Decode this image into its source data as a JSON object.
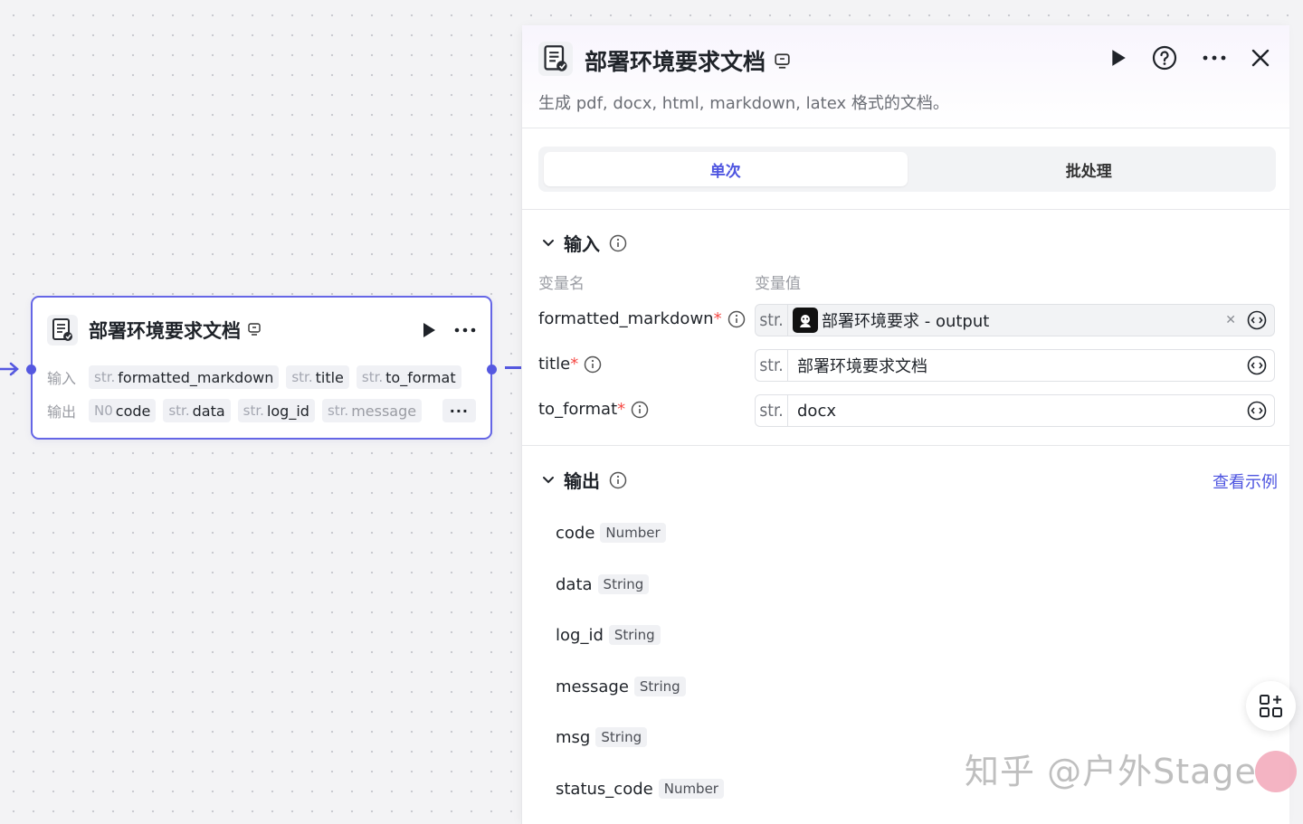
{
  "node": {
    "title": "部署环境要求文档",
    "input_label": "输入",
    "output_label": "输出",
    "inputs": [
      {
        "type": "str.",
        "name": "formatted_markdown"
      },
      {
        "type": "str.",
        "name": "title"
      },
      {
        "type": "str.",
        "name": "to_format"
      }
    ],
    "outputs": [
      {
        "type": "N0",
        "name": "code"
      },
      {
        "type": "str.",
        "name": "data"
      },
      {
        "type": "str.",
        "name": "log_id"
      },
      {
        "type": "str.",
        "name": "message"
      }
    ],
    "more": "···"
  },
  "panel": {
    "title": "部署环境要求文档",
    "description": "生成 pdf, docx, html, markdown, latex 格式的文档。",
    "tabs": [
      "单次",
      "批处理"
    ],
    "input_section": {
      "title": "输入",
      "col_name": "变量名",
      "col_value": "变量值",
      "rows": [
        {
          "label": "formatted_markdown",
          "required": "*",
          "type": "str.",
          "value": "部署环境要求 - output",
          "is_ref": true
        },
        {
          "label": "title",
          "required": "*",
          "type": "str.",
          "value": "部署环境要求文档",
          "is_ref": false
        },
        {
          "label": "to_format",
          "required": "*",
          "type": "str.",
          "value": "docx",
          "is_ref": false
        }
      ]
    },
    "output_section": {
      "title": "输出",
      "view_example": "查看示例",
      "rows": [
        {
          "name": "code",
          "type": "Number"
        },
        {
          "name": "data",
          "type": "String"
        },
        {
          "name": "log_id",
          "type": "String"
        },
        {
          "name": "message",
          "type": "String"
        },
        {
          "name": "msg",
          "type": "String"
        },
        {
          "name": "status_code",
          "type": "Number"
        }
      ]
    }
  },
  "watermark": "知乎 @户外Stage",
  "colors": {
    "accent": "#5558e0",
    "link": "#4e55e0",
    "required": "#f54a45"
  }
}
